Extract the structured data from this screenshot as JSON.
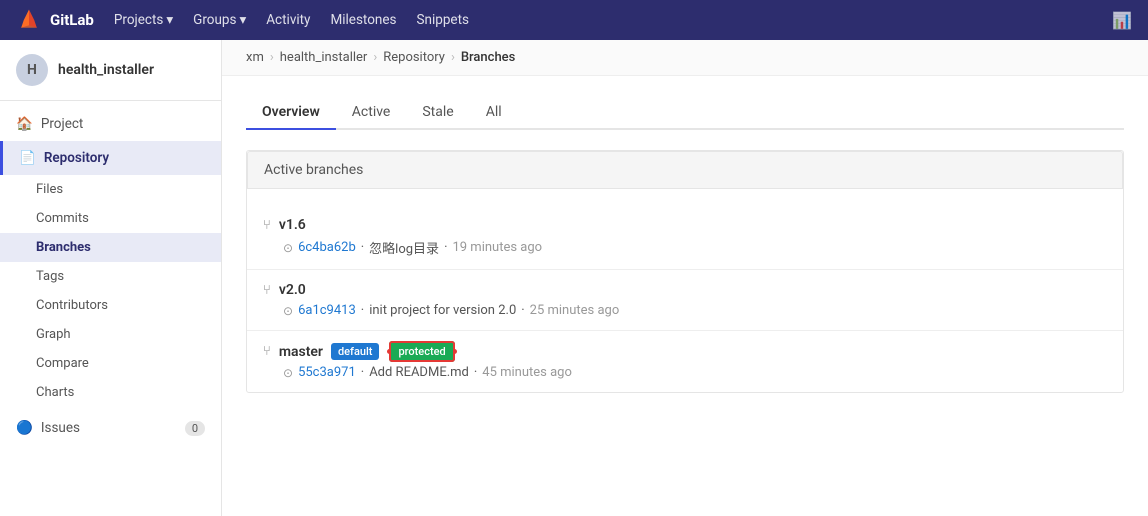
{
  "topnav": {
    "brand": "GitLab",
    "logo_alt": "gitlab-logo",
    "items": [
      {
        "label": "Projects",
        "has_dropdown": true
      },
      {
        "label": "Groups",
        "has_dropdown": true
      },
      {
        "label": "Activity"
      },
      {
        "label": "Milestones"
      },
      {
        "label": "Snippets"
      }
    ],
    "chart_icon": "bar-chart-icon"
  },
  "sidebar": {
    "avatar_letter": "H",
    "project_name": "health_installer",
    "nav": [
      {
        "label": "Project",
        "icon": "home-icon",
        "active": false,
        "sub": false
      },
      {
        "label": "Repository",
        "icon": "book-icon",
        "active": false,
        "sub": false,
        "is_section": true
      },
      {
        "label": "Files",
        "active": false,
        "sub": true
      },
      {
        "label": "Commits",
        "active": false,
        "sub": true
      },
      {
        "label": "Branches",
        "active": true,
        "sub": true
      },
      {
        "label": "Tags",
        "active": false,
        "sub": true
      },
      {
        "label": "Contributors",
        "active": false,
        "sub": true
      },
      {
        "label": "Graph",
        "active": false,
        "sub": true
      },
      {
        "label": "Compare",
        "active": false,
        "sub": true
      },
      {
        "label": "Charts",
        "active": false,
        "sub": true
      }
    ],
    "issues_label": "Issues",
    "issues_count": "0"
  },
  "breadcrumb": {
    "items": [
      "xm",
      "health_installer",
      "Repository",
      "Branches"
    ],
    "separators": [
      ">",
      ">",
      ">"
    ]
  },
  "tabs": {
    "items": [
      {
        "label": "Overview",
        "active": true
      },
      {
        "label": "Active",
        "active": false
      },
      {
        "label": "Stale",
        "active": false
      },
      {
        "label": "All",
        "active": false
      }
    ]
  },
  "content": {
    "section_title": "Active branches",
    "branches": [
      {
        "name": "v1.6",
        "badges": [],
        "commit_hash": "6c4ba62b",
        "commit_msg": "忽略log目录",
        "commit_time": "19 minutes ago"
      },
      {
        "name": "v2.0",
        "badges": [],
        "commit_hash": "6a1c9413",
        "commit_msg": "init project for version 2.0",
        "commit_time": "25 minutes ago"
      },
      {
        "name": "master",
        "badges": [
          {
            "label": "default",
            "type": "default"
          },
          {
            "label": "protected",
            "type": "protected"
          }
        ],
        "commit_hash": "55c3a971",
        "commit_msg": "Add README.md",
        "commit_time": "45 minutes ago"
      }
    ]
  }
}
